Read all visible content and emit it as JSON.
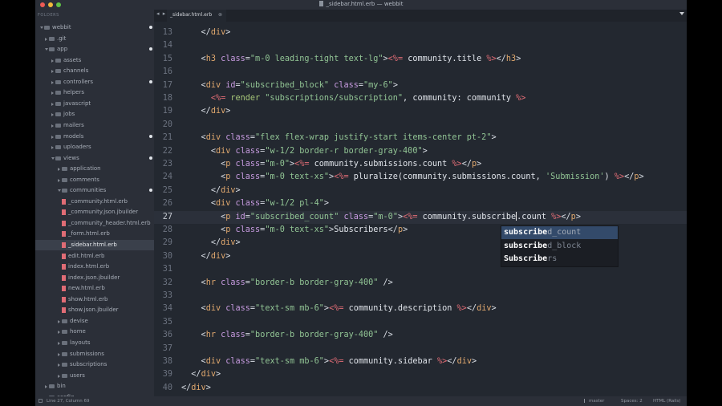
{
  "window": {
    "title": "_sidebar.html.erb — webbit"
  },
  "sidebar": {
    "heading": "FOLDERS",
    "items": [
      {
        "label": "webbit",
        "kind": "folder",
        "depth": 0,
        "open": true,
        "modified": true
      },
      {
        "label": ".git",
        "kind": "folder",
        "depth": 1,
        "open": false,
        "modified": false
      },
      {
        "label": "app",
        "kind": "folder",
        "depth": 1,
        "open": true,
        "modified": true
      },
      {
        "label": "assets",
        "kind": "folder",
        "depth": 2,
        "open": false,
        "modified": false
      },
      {
        "label": "channels",
        "kind": "folder",
        "depth": 2,
        "open": false,
        "modified": false
      },
      {
        "label": "controllers",
        "kind": "folder",
        "depth": 2,
        "open": false,
        "modified": true
      },
      {
        "label": "helpers",
        "kind": "folder",
        "depth": 2,
        "open": false,
        "modified": false
      },
      {
        "label": "javascript",
        "kind": "folder",
        "depth": 2,
        "open": false,
        "modified": false
      },
      {
        "label": "jobs",
        "kind": "folder",
        "depth": 2,
        "open": false,
        "modified": false
      },
      {
        "label": "mailers",
        "kind": "folder",
        "depth": 2,
        "open": false,
        "modified": false
      },
      {
        "label": "models",
        "kind": "folder",
        "depth": 2,
        "open": false,
        "modified": true
      },
      {
        "label": "uploaders",
        "kind": "folder",
        "depth": 2,
        "open": false,
        "modified": false
      },
      {
        "label": "views",
        "kind": "folder",
        "depth": 2,
        "open": true,
        "modified": true
      },
      {
        "label": "application",
        "kind": "folder",
        "depth": 3,
        "open": false,
        "modified": false
      },
      {
        "label": "comments",
        "kind": "folder",
        "depth": 3,
        "open": false,
        "modified": false
      },
      {
        "label": "communities",
        "kind": "folder",
        "depth": 3,
        "open": true,
        "modified": true
      },
      {
        "label": "_community.html.erb",
        "kind": "file",
        "depth": 4,
        "modified": false
      },
      {
        "label": "_community.json.jbuilder",
        "kind": "file",
        "depth": 4,
        "modified": false
      },
      {
        "label": "_community_header.html.erb",
        "kind": "file",
        "depth": 4,
        "modified": false
      },
      {
        "label": "_form.html.erb",
        "kind": "file",
        "depth": 4,
        "modified": false
      },
      {
        "label": "_sidebar.html.erb",
        "kind": "file",
        "depth": 4,
        "modified": false,
        "selected": true
      },
      {
        "label": "edit.html.erb",
        "kind": "file",
        "depth": 4,
        "modified": false
      },
      {
        "label": "index.html.erb",
        "kind": "file",
        "depth": 4,
        "modified": false
      },
      {
        "label": "index.json.jbuilder",
        "kind": "file",
        "depth": 4,
        "modified": false
      },
      {
        "label": "new.html.erb",
        "kind": "file",
        "depth": 4,
        "modified": false
      },
      {
        "label": "show.html.erb",
        "kind": "file",
        "depth": 4,
        "modified": false
      },
      {
        "label": "show.json.jbuilder",
        "kind": "file",
        "depth": 4,
        "modified": false
      },
      {
        "label": "devise",
        "kind": "folder",
        "depth": 3,
        "open": false,
        "modified": false
      },
      {
        "label": "home",
        "kind": "folder",
        "depth": 3,
        "open": false,
        "modified": false
      },
      {
        "label": "layouts",
        "kind": "folder",
        "depth": 3,
        "open": false,
        "modified": false
      },
      {
        "label": "submissions",
        "kind": "folder",
        "depth": 3,
        "open": false,
        "modified": false
      },
      {
        "label": "subscriptions",
        "kind": "folder",
        "depth": 3,
        "open": false,
        "modified": false
      },
      {
        "label": "users",
        "kind": "folder",
        "depth": 3,
        "open": false,
        "modified": false
      },
      {
        "label": "bin",
        "kind": "folder",
        "depth": 1,
        "open": false,
        "modified": false
      },
      {
        "label": "config",
        "kind": "folder",
        "depth": 1,
        "open": false,
        "modified": false
      }
    ]
  },
  "tabs": {
    "nav": "◂ ▸",
    "active": "_sidebar.html.erb",
    "close": "⊗"
  },
  "editor": {
    "current_line": 27,
    "lines": [
      {
        "n": "13",
        "t": [
          [
            "    ",
            "text"
          ],
          [
            "</",
            "punc"
          ],
          [
            "div",
            "tag"
          ],
          [
            ">",
            "punc"
          ]
        ]
      },
      {
        "n": "14",
        "t": []
      },
      {
        "n": "15",
        "t": [
          [
            "    ",
            "text"
          ],
          [
            "<",
            "punc"
          ],
          [
            "h3",
            "tag"
          ],
          [
            " ",
            "text"
          ],
          [
            "class",
            "attr"
          ],
          [
            "=",
            "punc"
          ],
          [
            "\"m-0 leading-tight text-lg\"",
            "str"
          ],
          [
            ">",
            "punc"
          ],
          [
            "<%=",
            "erb"
          ],
          [
            " community.title ",
            "text"
          ],
          [
            "%>",
            "erb"
          ],
          [
            "</",
            "punc"
          ],
          [
            "h3",
            "tag"
          ],
          [
            ">",
            "punc"
          ]
        ]
      },
      {
        "n": "16",
        "t": []
      },
      {
        "n": "17",
        "t": [
          [
            "    ",
            "text"
          ],
          [
            "<",
            "punc"
          ],
          [
            "div",
            "tag"
          ],
          [
            " ",
            "text"
          ],
          [
            "id",
            "attr"
          ],
          [
            "=",
            "punc"
          ],
          [
            "\"subscribed_block\"",
            "str"
          ],
          [
            " ",
            "text"
          ],
          [
            "class",
            "attr"
          ],
          [
            "=",
            "punc"
          ],
          [
            "\"my-6\"",
            "str"
          ],
          [
            ">",
            "punc"
          ]
        ]
      },
      {
        "n": "18",
        "t": [
          [
            "      ",
            "text"
          ],
          [
            "<%=",
            "erb"
          ],
          [
            " render ",
            "kw"
          ],
          [
            "\"subscriptions/subscription\"",
            "str"
          ],
          [
            ", community: community ",
            "text"
          ],
          [
            "%>",
            "erb"
          ]
        ]
      },
      {
        "n": "19",
        "t": [
          [
            "    ",
            "text"
          ],
          [
            "</",
            "punc"
          ],
          [
            "div",
            "tag"
          ],
          [
            ">",
            "punc"
          ]
        ]
      },
      {
        "n": "20",
        "t": []
      },
      {
        "n": "21",
        "t": [
          [
            "    ",
            "text"
          ],
          [
            "<",
            "punc"
          ],
          [
            "div",
            "tag"
          ],
          [
            " ",
            "text"
          ],
          [
            "class",
            "attr"
          ],
          [
            "=",
            "punc"
          ],
          [
            "\"flex flex-wrap justify-start items-center pt-2\"",
            "str"
          ],
          [
            ">",
            "punc"
          ]
        ]
      },
      {
        "n": "22",
        "t": [
          [
            "      ",
            "text"
          ],
          [
            "<",
            "punc"
          ],
          [
            "div",
            "tag"
          ],
          [
            " ",
            "text"
          ],
          [
            "class",
            "attr"
          ],
          [
            "=",
            "punc"
          ],
          [
            "\"w-1/2 border-r border-gray-400\"",
            "str"
          ],
          [
            ">",
            "punc"
          ]
        ]
      },
      {
        "n": "23",
        "t": [
          [
            "        ",
            "text"
          ],
          [
            "<",
            "punc"
          ],
          [
            "p",
            "tag"
          ],
          [
            " ",
            "text"
          ],
          [
            "class",
            "attr"
          ],
          [
            "=",
            "punc"
          ],
          [
            "\"m-0\"",
            "str"
          ],
          [
            ">",
            "punc"
          ],
          [
            "<%=",
            "erb"
          ],
          [
            " community.submissions.count ",
            "text"
          ],
          [
            "%>",
            "erb"
          ],
          [
            "</",
            "punc"
          ],
          [
            "p",
            "tag"
          ],
          [
            ">",
            "punc"
          ]
        ]
      },
      {
        "n": "24",
        "t": [
          [
            "        ",
            "text"
          ],
          [
            "<",
            "punc"
          ],
          [
            "p",
            "tag"
          ],
          [
            " ",
            "text"
          ],
          [
            "class",
            "attr"
          ],
          [
            "=",
            "punc"
          ],
          [
            "\"m-0 text-xs\"",
            "str"
          ],
          [
            ">",
            "punc"
          ],
          [
            "<%=",
            "erb"
          ],
          [
            " pluralize(community.submissions.count, ",
            "text"
          ],
          [
            "'Submission'",
            "str"
          ],
          [
            ") ",
            "text"
          ],
          [
            "%>",
            "erb"
          ],
          [
            "</",
            "punc"
          ],
          [
            "p",
            "tag"
          ],
          [
            ">",
            "punc"
          ]
        ]
      },
      {
        "n": "25",
        "t": [
          [
            "      ",
            "text"
          ],
          [
            "</",
            "punc"
          ],
          [
            "div",
            "tag"
          ],
          [
            ">",
            "punc"
          ]
        ]
      },
      {
        "n": "26",
        "t": [
          [
            "      ",
            "text"
          ],
          [
            "<",
            "punc"
          ],
          [
            "div",
            "tag"
          ],
          [
            " ",
            "text"
          ],
          [
            "class",
            "attr"
          ],
          [
            "=",
            "punc"
          ],
          [
            "\"w-1/2 pl-4\"",
            "str"
          ],
          [
            ">",
            "punc"
          ]
        ]
      },
      {
        "n": "27",
        "t": [
          [
            "        ",
            "text"
          ],
          [
            "<",
            "punc"
          ],
          [
            "p",
            "tag"
          ],
          [
            " ",
            "text"
          ],
          [
            "id",
            "attr"
          ],
          [
            "=",
            "punc"
          ],
          [
            "\"subscribed_count\"",
            "str"
          ],
          [
            " ",
            "text"
          ],
          [
            "class",
            "attr"
          ],
          [
            "=",
            "punc"
          ],
          [
            "\"m-0\"",
            "str"
          ],
          [
            ">",
            "punc"
          ],
          [
            "<%=",
            "erb"
          ],
          [
            " community.subscribe",
            "text"
          ],
          [
            "|",
            "cursor"
          ],
          [
            ".count ",
            "text"
          ],
          [
            "%>",
            "erb"
          ],
          [
            "</",
            "punc"
          ],
          [
            "p",
            "tag"
          ],
          [
            ">",
            "punc"
          ]
        ]
      },
      {
        "n": "28",
        "t": [
          [
            "        ",
            "text"
          ],
          [
            "<",
            "punc"
          ],
          [
            "p",
            "tag"
          ],
          [
            " ",
            "text"
          ],
          [
            "class",
            "attr"
          ],
          [
            "=",
            "punc"
          ],
          [
            "\"m-0 text-xs\"",
            "str"
          ],
          [
            ">",
            "punc"
          ],
          [
            "Subscribers",
            "text"
          ],
          [
            "</",
            "punc"
          ],
          [
            "p",
            "tag"
          ],
          [
            ">",
            "punc"
          ]
        ]
      },
      {
        "n": "29",
        "t": [
          [
            "      ",
            "text"
          ],
          [
            "</",
            "punc"
          ],
          [
            "div",
            "tag"
          ],
          [
            ">",
            "punc"
          ]
        ]
      },
      {
        "n": "30",
        "t": [
          [
            "    ",
            "text"
          ],
          [
            "</",
            "punc"
          ],
          [
            "div",
            "tag"
          ],
          [
            ">",
            "punc"
          ]
        ]
      },
      {
        "n": "31",
        "t": []
      },
      {
        "n": "32",
        "t": [
          [
            "    ",
            "text"
          ],
          [
            "<",
            "punc"
          ],
          [
            "hr",
            "tag"
          ],
          [
            " ",
            "text"
          ],
          [
            "class",
            "attr"
          ],
          [
            "=",
            "punc"
          ],
          [
            "\"border-b border-gray-400\"",
            "str"
          ],
          [
            " />",
            "punc"
          ]
        ]
      },
      {
        "n": "33",
        "t": []
      },
      {
        "n": "34",
        "t": [
          [
            "    ",
            "text"
          ],
          [
            "<",
            "punc"
          ],
          [
            "div",
            "tag"
          ],
          [
            " ",
            "text"
          ],
          [
            "class",
            "attr"
          ],
          [
            "=",
            "punc"
          ],
          [
            "\"text-sm mb-6\"",
            "str"
          ],
          [
            ">",
            "punc"
          ],
          [
            "<%=",
            "erb"
          ],
          [
            " community.description ",
            "text"
          ],
          [
            "%>",
            "erb"
          ],
          [
            "</",
            "punc"
          ],
          [
            "div",
            "tag"
          ],
          [
            ">",
            "punc"
          ]
        ]
      },
      {
        "n": "35",
        "t": []
      },
      {
        "n": "36",
        "t": [
          [
            "    ",
            "text"
          ],
          [
            "<",
            "punc"
          ],
          [
            "hr",
            "tag"
          ],
          [
            " ",
            "text"
          ],
          [
            "class",
            "attr"
          ],
          [
            "=",
            "punc"
          ],
          [
            "\"border-b border-gray-400\"",
            "str"
          ],
          [
            " />",
            "punc"
          ]
        ]
      },
      {
        "n": "37",
        "t": []
      },
      {
        "n": "38",
        "t": [
          [
            "    ",
            "text"
          ],
          [
            "<",
            "punc"
          ],
          [
            "div",
            "tag"
          ],
          [
            " ",
            "text"
          ],
          [
            "class",
            "attr"
          ],
          [
            "=",
            "punc"
          ],
          [
            "\"text-sm mb-6\"",
            "str"
          ],
          [
            ">",
            "punc"
          ],
          [
            "<%=",
            "erb"
          ],
          [
            " community.sidebar ",
            "text"
          ],
          [
            "%>",
            "erb"
          ],
          [
            "</",
            "punc"
          ],
          [
            "div",
            "tag"
          ],
          [
            ">",
            "punc"
          ]
        ]
      },
      {
        "n": "39",
        "t": [
          [
            "  ",
            "text"
          ],
          [
            "</",
            "punc"
          ],
          [
            "div",
            "tag"
          ],
          [
            ">",
            "punc"
          ]
        ]
      },
      {
        "n": "40",
        "t": [
          [
            "</",
            "punc"
          ],
          [
            "div",
            "tag"
          ],
          [
            ">",
            "punc"
          ]
        ]
      }
    ]
  },
  "autocomplete": {
    "items": [
      {
        "match": "subscribe",
        "rest": "d_count",
        "selected": true
      },
      {
        "match": "subscribe",
        "rest": "d_block",
        "selected": false
      },
      {
        "match": "Subscribe",
        "rest": "rs",
        "selected": false
      }
    ]
  },
  "statusbar": {
    "position": "Line 27, Column 69",
    "branch": "master",
    "spaces": "Spaces: 2",
    "syntax": "HTML (Rails)"
  },
  "colors": {
    "close": "#ee5b55",
    "minimize": "#f2b93b",
    "maximize": "#5fc246",
    "file_icon": "#e06c75"
  }
}
